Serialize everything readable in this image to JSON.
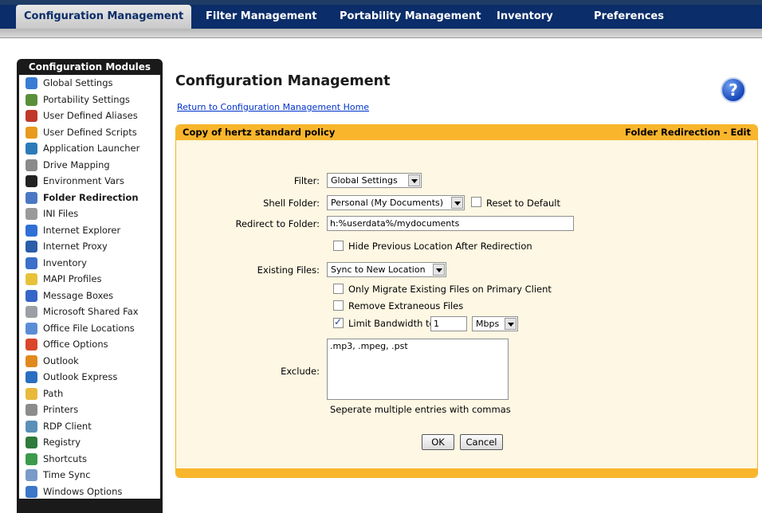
{
  "nav": {
    "tabs": [
      {
        "label": "Configuration Management",
        "active": true
      },
      {
        "label": "Filter Management"
      },
      {
        "label": "Portability Management"
      },
      {
        "label": "Inventory"
      },
      {
        "label": "Preferences"
      }
    ]
  },
  "sidebar": {
    "title": "Configuration Modules",
    "items": [
      {
        "label": "Global Settings",
        "icon": "globe-icon",
        "color": "#3a7bd5"
      },
      {
        "label": "Portability Settings",
        "icon": "portability-icon",
        "color": "#5a8f3a"
      },
      {
        "label": "User Defined Aliases",
        "icon": "users-icon",
        "color": "#c0392b"
      },
      {
        "label": "User Defined Scripts",
        "icon": "script-icon",
        "color": "#e69b1e"
      },
      {
        "label": "Application Launcher",
        "icon": "app-launcher-icon",
        "color": "#2b7bb9"
      },
      {
        "label": "Drive Mapping",
        "icon": "drive-icon",
        "color": "#8a8a8a"
      },
      {
        "label": "Environment Vars",
        "icon": "console-icon",
        "color": "#222222"
      },
      {
        "label": "Folder Redirection",
        "icon": "folder-redirect-icon",
        "color": "#4a78c2",
        "active": true
      },
      {
        "label": "INI Files",
        "icon": "ini-file-icon",
        "color": "#9a9a9a"
      },
      {
        "label": "Internet Explorer",
        "icon": "internet-explorer-icon",
        "color": "#2f6fd6"
      },
      {
        "label": "Internet Proxy",
        "icon": "proxy-icon",
        "color": "#2a5ea8"
      },
      {
        "label": "Inventory",
        "icon": "inventory-icon",
        "color": "#3b6fc9"
      },
      {
        "label": "MAPI Profiles",
        "icon": "mapi-icon",
        "color": "#e6c23a"
      },
      {
        "label": "Message Boxes",
        "icon": "info-icon",
        "color": "#3565c8"
      },
      {
        "label": "Microsoft Shared Fax",
        "icon": "fax-icon",
        "color": "#9aa0a6"
      },
      {
        "label": "Office File Locations",
        "icon": "office-files-icon",
        "color": "#5b8dd6"
      },
      {
        "label": "Office Options",
        "icon": "office-options-icon",
        "color": "#d9462b"
      },
      {
        "label": "Outlook",
        "icon": "outlook-icon",
        "color": "#e08a1e"
      },
      {
        "label": "Outlook Express",
        "icon": "outlook-express-icon",
        "color": "#2a6fc0"
      },
      {
        "label": "Path",
        "icon": "folder-icon",
        "color": "#e8b93a"
      },
      {
        "label": "Printers",
        "icon": "printer-icon",
        "color": "#8c8c8c"
      },
      {
        "label": "RDP Client",
        "icon": "rdp-icon",
        "color": "#5a8fb8"
      },
      {
        "label": "Registry",
        "icon": "registry-icon",
        "color": "#2f7a3c"
      },
      {
        "label": "Shortcuts",
        "icon": "shortcut-icon",
        "color": "#3c9a4b"
      },
      {
        "label": "Time Sync",
        "icon": "time-sync-icon",
        "color": "#7a9ac8"
      },
      {
        "label": "Windows Options",
        "icon": "windows-options-icon",
        "color": "#3c77c8"
      }
    ]
  },
  "main": {
    "title": "Configuration Management",
    "home_link": "Return to Configuration Management Home",
    "help": "?",
    "panel": {
      "left_title": "Copy of hertz standard policy",
      "right_title": "Folder Redirection - Edit"
    },
    "form": {
      "filter_label": "Filter:",
      "filter_value": "Global Settings",
      "shell_label": "Shell Folder:",
      "shell_value": "Personal (My Documents)",
      "reset_label": "Reset to Default",
      "redirect_label": "Redirect to Folder:",
      "redirect_value": "h:%userdata%/mydocuments",
      "hide_prev_label": "Hide Previous Location After Redirection",
      "existing_label": "Existing Files:",
      "existing_value": "Sync to New Location",
      "only_migrate_label": "Only Migrate Existing Files on Primary Client",
      "remove_label": "Remove Extraneous Files",
      "limit_label": "Limit Bandwidth to",
      "limit_value": "1",
      "limit_unit": "Mbps",
      "exclude_label": "Exclude:",
      "exclude_value": ".mp3, .mpeg, .pst",
      "exclude_hint": "Seperate multiple entries with commas",
      "ok_label": "OK",
      "cancel_label": "Cancel"
    },
    "colors": {
      "accent": "#f9b52c",
      "nav": "#0b2d69",
      "panel_bg": "#fdf7e3"
    }
  }
}
